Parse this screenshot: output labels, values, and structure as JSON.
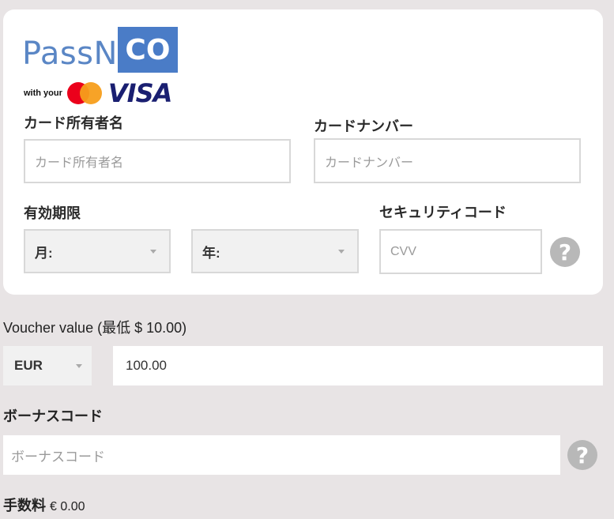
{
  "brand": {
    "name_prefix": "PassN",
    "name_box": "CO",
    "with_your": "with your",
    "visa": "VISA"
  },
  "card_form": {
    "holder_label": "カード所有者名",
    "holder_placeholder": "カード所有者名",
    "number_label": "カードナンバー",
    "number_placeholder": "カードナンバー",
    "expiry_label": "有効期限",
    "month_selected": "月:",
    "year_selected": "年:",
    "security_label": "セキュリティコード",
    "cvv_placeholder": "CVV",
    "help_icon": "question-mark"
  },
  "voucher": {
    "label": "Voucher value",
    "min_text": "(最低 $ 10.00)",
    "currency_selected": "EUR",
    "amount_value": "100.00"
  },
  "bonus": {
    "label": "ボーナスコード",
    "placeholder": "ボーナスコード",
    "help_icon": "question-mark"
  },
  "fee": {
    "label": "手数料",
    "value": "€ 0.00"
  },
  "colors": {
    "background": "#e8e4e5",
    "brand_blue": "#4a7cc7",
    "visa_navy": "#1a1f71",
    "mastercard_red": "#eb001b",
    "mastercard_orange": "#f79e1b"
  }
}
